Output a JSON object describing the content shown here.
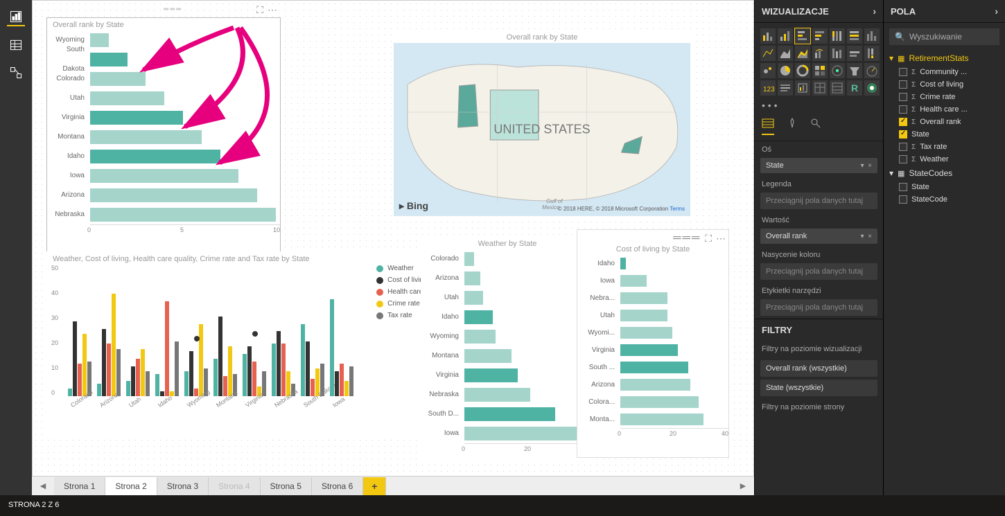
{
  "status_bar": "STRONA 2 Z 6",
  "left_rail": [
    "report",
    "data",
    "model"
  ],
  "pages": [
    "Strona 1",
    "Strona 2",
    "Strona 3",
    "Strona 4",
    "Strona 5",
    "Strona 6"
  ],
  "selected_page_index": 1,
  "dimmed_page_index": 3,
  "panes": {
    "viz_title": "WIZUALIZACJE",
    "fields_title": "POLA",
    "search_placeholder": "Wyszukiwanie",
    "filters_title": "FILTRY",
    "filters_level": "Filtry na poziomie wizualizacji",
    "filters_page": "Filtry na poziomie strony",
    "filter_items": [
      "Overall rank (wszystkie)",
      "State (wszystkie)"
    ],
    "wells": {
      "axis": {
        "label": "Oś",
        "items": [
          "State"
        ]
      },
      "legend": {
        "label": "Legenda",
        "placeholder": "Przeciągnij pola danych tutaj"
      },
      "value": {
        "label": "Wartość",
        "items": [
          "Overall rank"
        ]
      },
      "saturation": {
        "label": "Nasycenie koloru",
        "placeholder": "Przeciągnij pola danych tutaj"
      },
      "tooltips": {
        "label": "Etykietki narzędzi",
        "placeholder": "Przeciągnij pola danych tutaj"
      }
    }
  },
  "fields": {
    "tables": [
      {
        "name": "RetirementStats",
        "expanded": true,
        "highlight": true,
        "fields": [
          {
            "name": "Community ...",
            "agg": true
          },
          {
            "name": "Cost of living",
            "agg": true
          },
          {
            "name": "Crime rate",
            "agg": true
          },
          {
            "name": "Health care ...",
            "agg": true
          },
          {
            "name": "Overall rank",
            "agg": true,
            "checked": true
          },
          {
            "name": "State",
            "checked": true
          },
          {
            "name": "Tax rate",
            "agg": true
          },
          {
            "name": "Weather",
            "agg": true
          }
        ]
      },
      {
        "name": "StateCodes",
        "expanded": true,
        "fields": [
          {
            "name": "State"
          },
          {
            "name": "StateCode"
          }
        ]
      }
    ]
  },
  "map": {
    "title": "Overall rank by State",
    "center_label": "UNITED STATES",
    "bing": "Bing",
    "attrib": "© 2018 HERE, © 2018 Microsoft Corporation",
    "terms": "Terms",
    "gulf": "Gulf of",
    "mexico": "Mexico"
  },
  "chart_data": [
    {
      "id": "overall_rank",
      "title": "Overall rank by State",
      "type": "bar",
      "orientation": "horizontal",
      "xlim": [
        0,
        10
      ],
      "xticks": [
        0,
        5,
        10
      ],
      "categories": [
        "Wyoming",
        "South Dakota",
        "Colorado",
        "Utah",
        "Virginia",
        "Montana",
        "Idaho",
        "Iowa",
        "Arizona",
        "Nebraska"
      ],
      "values": [
        1,
        2,
        3,
        4,
        5,
        6,
        7,
        8,
        9,
        10
      ],
      "highlighted": [
        "South Dakota",
        "Virginia",
        "Idaho"
      ]
    },
    {
      "id": "multi",
      "title": "Weather, Cost of living, Health care quality, Crime rate and Tax rate by State",
      "type": "bar",
      "orientation": "vertical",
      "ylim": [
        0,
        50
      ],
      "yticks": [
        0,
        10,
        20,
        30,
        40,
        50
      ],
      "categories": [
        "Colorado",
        "Arizona",
        "Utah",
        "Idaho",
        "Wyoming",
        "Montana",
        "Virginia",
        "Nebraska",
        "South Dakota",
        "Iowa"
      ],
      "series": [
        {
          "name": "Weather",
          "color": "#4fb3a4",
          "values": [
            3,
            5,
            6,
            9,
            10,
            15,
            17,
            21,
            29,
            39
          ]
        },
        {
          "name": "Cost of living",
          "color": "#333333",
          "values": [
            30,
            27,
            12,
            2,
            18,
            32,
            20,
            26,
            22,
            10
          ]
        },
        {
          "name": "Health care quality",
          "color": "#e6614f",
          "values": [
            13,
            21,
            15,
            38,
            3,
            8,
            14,
            21,
            7,
            13
          ]
        },
        {
          "name": "Crime rate",
          "color": "#f2c811",
          "values": [
            25,
            41,
            19,
            2,
            29,
            20,
            4,
            10,
            11,
            6
          ]
        },
        {
          "name": "Tax rate",
          "color": "#777777",
          "values": [
            14,
            19,
            10,
            22,
            11,
            9,
            10,
            5,
            13,
            12
          ]
        }
      ],
      "markers": [
        {
          "category": "Wyoming",
          "value": 22
        },
        {
          "category": "Virginia",
          "value": 24
        }
      ]
    },
    {
      "id": "weather",
      "title": "Weather by State",
      "type": "bar",
      "orientation": "horizontal",
      "xlim": [
        0,
        40
      ],
      "xticks": [
        0,
        20,
        40
      ],
      "categories": [
        "Colorado",
        "Arizona",
        "Utah",
        "Idaho",
        "Wyoming",
        "Montana",
        "Virginia",
        "Nebraska",
        "South D...",
        "Iowa"
      ],
      "values": [
        3,
        5,
        6,
        9,
        10,
        15,
        17,
        21,
        29,
        39
      ],
      "highlighted": [
        "Idaho",
        "Virginia",
        "South D..."
      ]
    },
    {
      "id": "cost",
      "title": "Cost of living by State",
      "type": "bar",
      "orientation": "horizontal",
      "xlim": [
        0,
        40
      ],
      "xticks": [
        0,
        20,
        40
      ],
      "categories": [
        "Idaho",
        "Iowa",
        "Nebra...",
        "Utah",
        "Wyomi...",
        "Virginia",
        "South ...",
        "Arizona",
        "Colora...",
        "Monta..."
      ],
      "values": [
        2,
        10,
        18,
        18,
        20,
        22,
        26,
        27,
        30,
        32
      ],
      "highlighted": [
        "Idaho",
        "Virginia",
        "South ..."
      ]
    }
  ]
}
